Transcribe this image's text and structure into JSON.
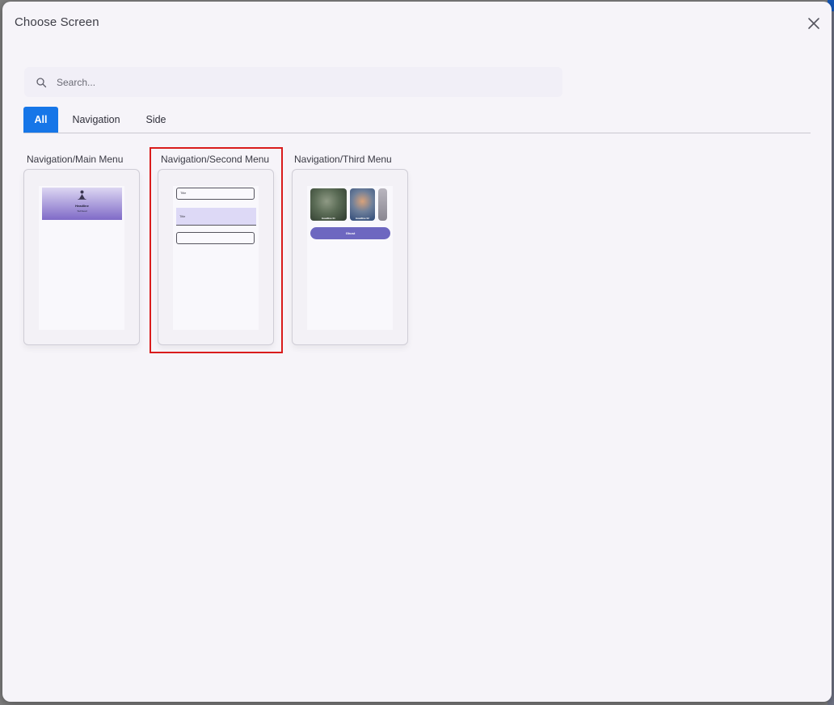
{
  "dialog": {
    "title": "Choose Screen",
    "close_icon": "close-icon"
  },
  "search": {
    "placeholder": "Search...",
    "value": "",
    "icon": "search-icon"
  },
  "tabs": [
    {
      "label": "All",
      "active": true
    },
    {
      "label": "Navigation",
      "active": false
    },
    {
      "label": "Side",
      "active": false
    }
  ],
  "screens": [
    {
      "label": "Navigation/Main Menu",
      "preview": {
        "title": "Headline",
        "subtitle": "Subhead"
      }
    },
    {
      "label": "Navigation/Second Menu",
      "selected": true,
      "preview": {
        "field_1": "Title",
        "field_2": "Title",
        "field_3": ""
      }
    },
    {
      "label": "Navigation/Third Menu",
      "preview": {
        "card_1": "Headline 01",
        "card_2": "Headline 02",
        "button": "Ghost"
      }
    }
  ],
  "colors": {
    "accent": "#1676e8",
    "selection": "#d91c1c",
    "preview_primary": "#6d67c0"
  }
}
